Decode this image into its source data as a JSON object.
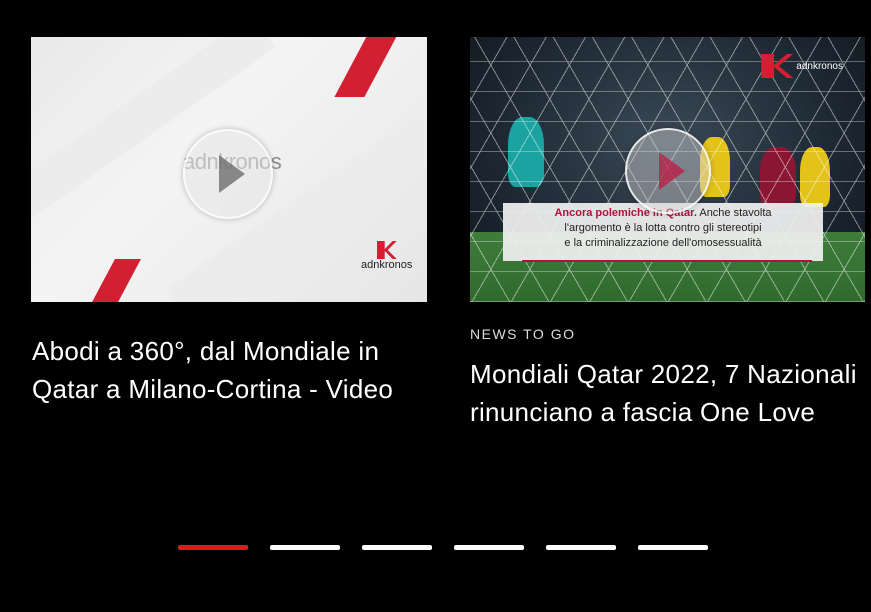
{
  "carousel": {
    "cards": [
      {
        "thumbnail": {
          "watermark": "adnkronos",
          "brand": "adnkronos"
        },
        "kicker": "",
        "title": "Abodi a 360°, dal Mondiale in Qatar a Milano-Cortina - Video"
      },
      {
        "thumbnail": {
          "brand": "adnkronos",
          "caption_highlight": "Ancora polemiche in Qatar.",
          "caption_rest_1": " Anche stavolta",
          "caption_line_2": "l'argomento è la lotta contro gli stereotipi",
          "caption_line_3": "e la criminalizzazione dell'omosessualità"
        },
        "kicker": "NEWS TO GO",
        "title": "Mondiali Qatar 2022, 7 Nazionali rinunciano a fascia One Love"
      }
    ],
    "pagination": {
      "count": 6,
      "active_index": 0
    }
  },
  "colors": {
    "background": "#000000",
    "accent_red": "#e0181f",
    "brand_red": "#d21f31",
    "caption_magenta": "#b0123b"
  }
}
